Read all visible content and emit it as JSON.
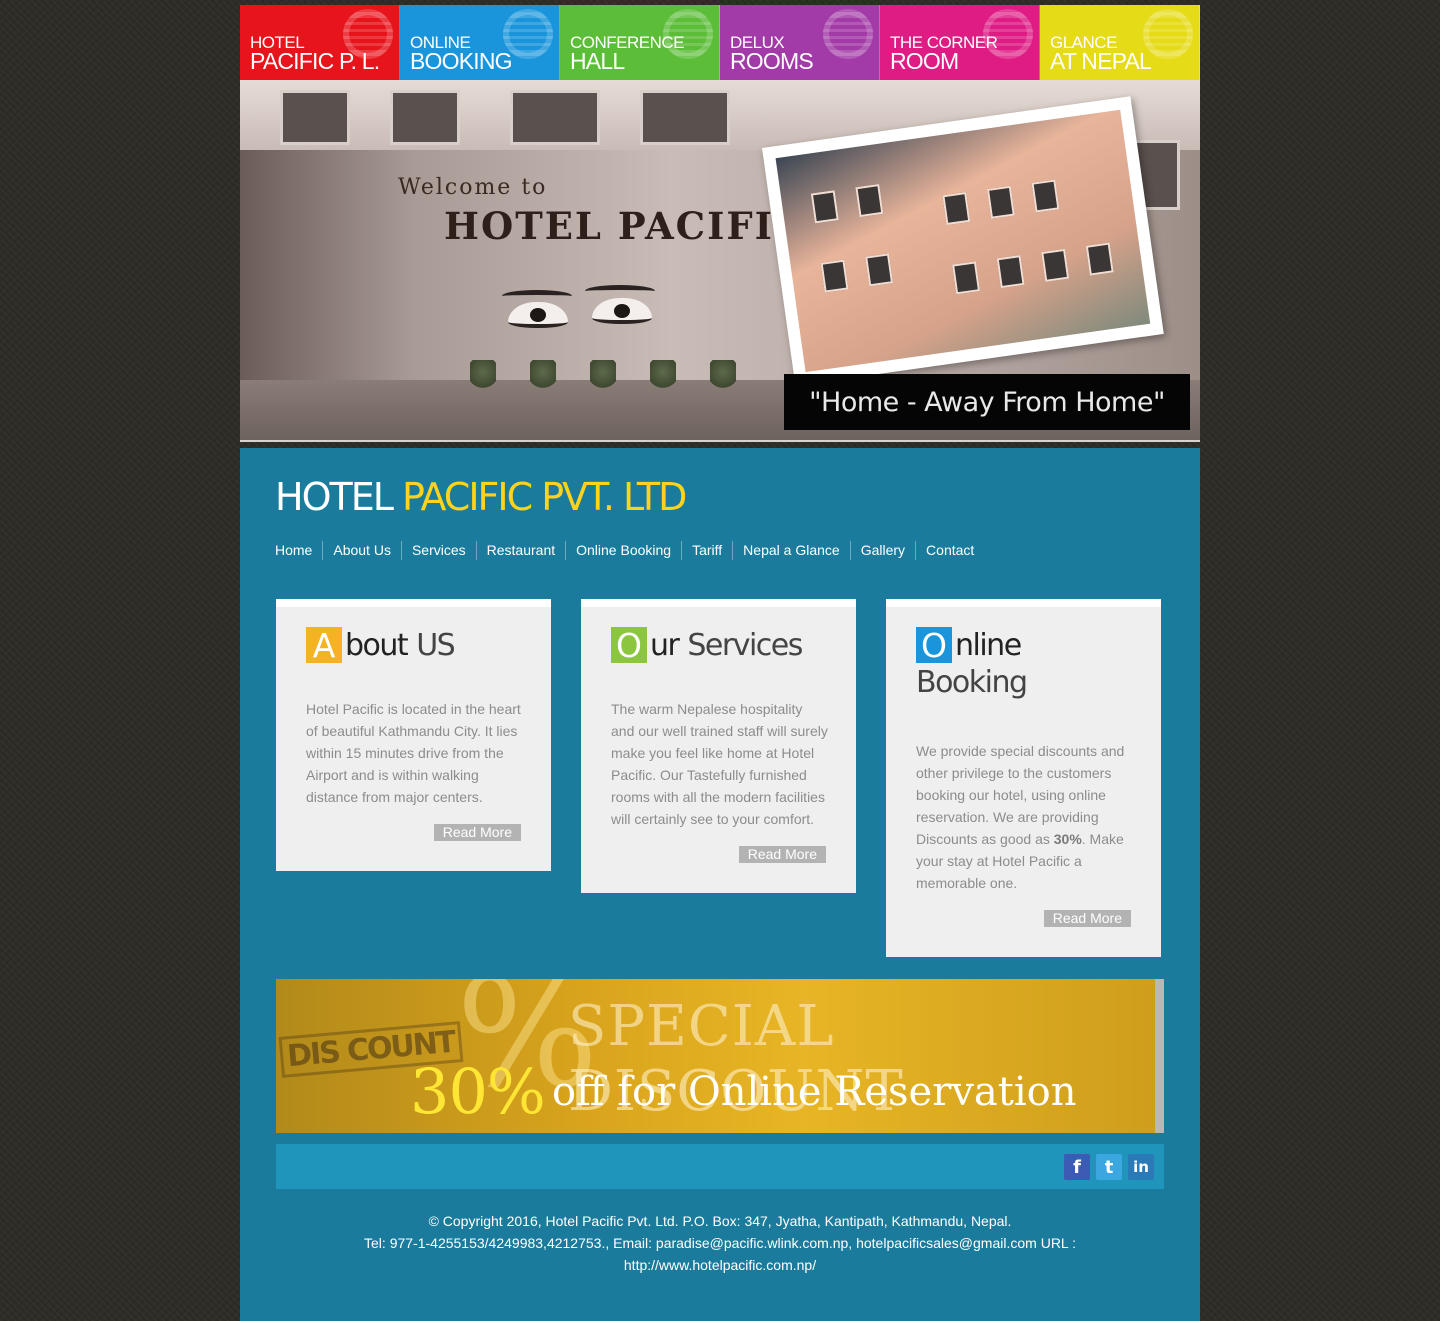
{
  "tabs": [
    {
      "line1": "HOTEL",
      "line2": "PACIFIC P. L.",
      "color": "#e8141c"
    },
    {
      "line1": "ONLINE",
      "line2": "BOOKING",
      "color": "#1a95dc"
    },
    {
      "line1": "CONFERENCE",
      "line2": "HALL",
      "color": "#5cbd39"
    },
    {
      "line1": "DELUX",
      "line2": "ROOMS",
      "color": "#a23aa7"
    },
    {
      "line1": "THE CORNER",
      "line2": "ROOM",
      "color": "#de1c84"
    },
    {
      "line1": "GLANCE",
      "line2": "AT NEPAL",
      "color": "#e6db17"
    }
  ],
  "banner": {
    "welcome": "Welcome to",
    "hotel": "HOTEL PACIFIC",
    "tagline": "\"Home - Away From Home\""
  },
  "logo": {
    "part1": "HOTEL",
    "part2": "PACIFIC PVT. LTD"
  },
  "nav": [
    "Home",
    "About Us",
    "Services",
    "Restaurant",
    "Online Booking",
    "Tariff",
    "Nepal a Glance",
    "Gallery",
    "Contact"
  ],
  "boxes": {
    "about": {
      "cap": "A",
      "rest_bold": "bout",
      "rest_light": "US",
      "cap_color": "#f5b323",
      "text": "Hotel Pacific is located in the heart of beautiful Kathmandu City. It lies within 15 minutes drive from the Airport and is within walking distance from major centers.",
      "read_more": "Read More"
    },
    "services": {
      "cap": "O",
      "rest_bold": "ur",
      "rest_light": "Services",
      "cap_color": "#8cc63f",
      "text": "The warm Nepalese hospitality and our well trained staff will surely make you feel like home at Hotel Pacific. Our Tastefully furnished rooms with all the modern facilities will certainly see to your comfort.",
      "read_more": "Read More"
    },
    "booking": {
      "cap": "O",
      "rest_bold": "nline",
      "rest_light": "Booking",
      "cap_color": "#1a95dc",
      "text_before": "We provide special discounts and other privilege to the customers booking our hotel, using online reservation. We are providing Discounts as good as ",
      "text_bold": "30%",
      "text_after": ". Make your stay at Hotel Pacific a memorable one.",
      "read_more": "Read More"
    }
  },
  "promo": {
    "stamp": "DIS COUNT",
    "pct_symbol": "%",
    "title": "SPECIAL DISCOUNT",
    "percent": "30%",
    "offer": "off for Online Reservation"
  },
  "social": [
    {
      "name": "facebook",
      "glyph": "f",
      "color": "#3b5bb5"
    },
    {
      "name": "twitter",
      "glyph": "t",
      "color": "#3aa7e0"
    },
    {
      "name": "linkedin",
      "glyph": "in",
      "color": "#2a7ab8"
    }
  ],
  "footer": {
    "line1": "© Copyright 2016, Hotel Pacific Pvt. Ltd. P.O. Box: 347, Jyatha, Kantipath, Kathmandu, Nepal.",
    "line2": "Tel: 977-1-4255153/4249983,4212753., Email: paradise@pacific.wlink.com.np, hotelpacificsales@gmail.com URL : http://www.hotelpacific.com.np/"
  }
}
